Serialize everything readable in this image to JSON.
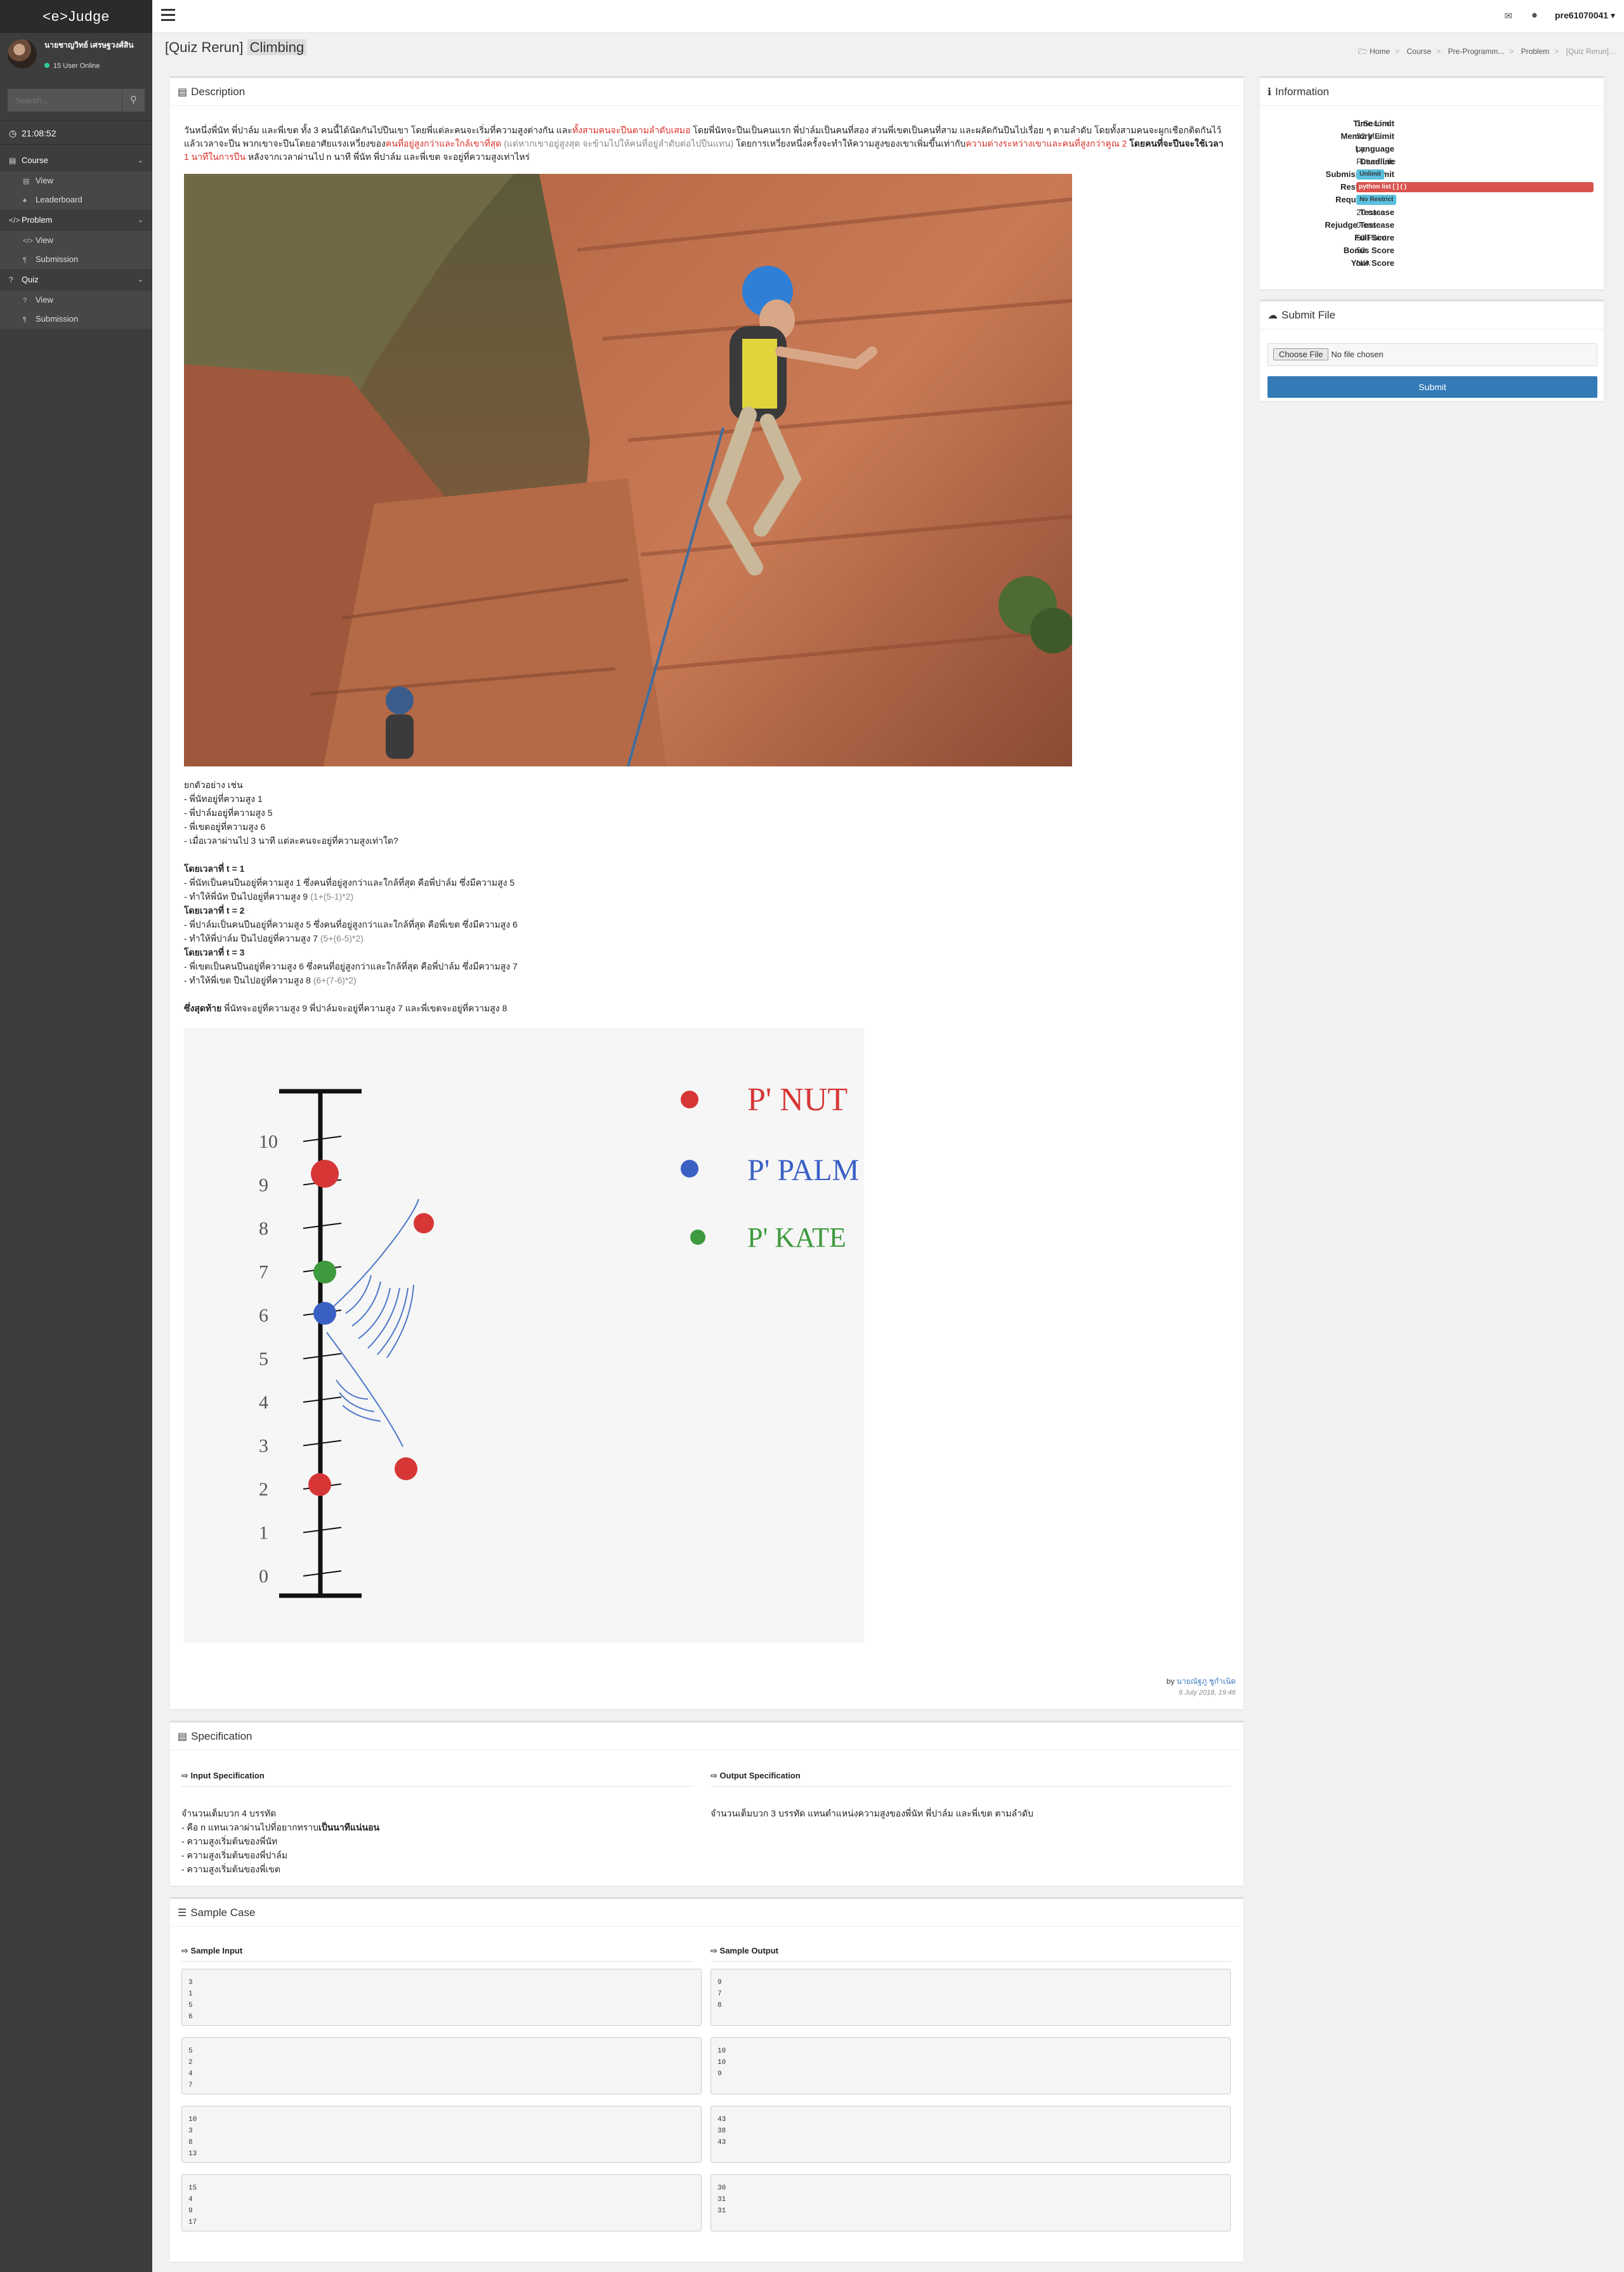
{
  "sidebar": {
    "brand": "<e>Judge",
    "user_name": "นายชาญวิทย์ เศรษฐวงศ์สิน",
    "online": "15 User Online",
    "search_placeholder": "Search...",
    "clock": "21:08:52",
    "course": {
      "label": "Course",
      "items": [
        "View",
        "Leaderboard"
      ]
    },
    "problem": {
      "label": "Problem",
      "items": [
        "View",
        "Submission"
      ]
    },
    "quiz": {
      "label": "Quiz",
      "items": [
        "View",
        "Submission"
      ]
    }
  },
  "topbar": {
    "user": "pre61070041 ▾"
  },
  "header": {
    "title_prefix": "[Quiz Rerun] ",
    "title_highlight": "Climbing",
    "breadcrumb": [
      "Home",
      "Course",
      "Pre-Programm...",
      "Problem",
      "[Quiz Rerun]..."
    ]
  },
  "description": {
    "title": "Description",
    "p1_a": "วันหนึ่งพี่นัท พี่ปาล์ม และพี่เขต ทั้ง 3 คนนี้ได้นัดกันไปปีนเขา โดยพี่แต่ละคนจะเริ่มที่ความสูงต่างกัน และ",
    "p1_red": "ทั้งสามคนจะปีนตามลำดับเสมอ",
    "p1_b": " โดยพี่นัทจะปีนเป็นคนแรก พี่ปาล์มเป็นคนที่สอง ส่วนพี่เขตเป็นคนที่สาม และผลัดกันปีนไปเรื่อย ๆ ตามลำดับ โดยทั้งสามคนจะผูกเชือกติดกันไว้ แล้วเวลาจะปีน พวกเขาจะปีนโดยอาศัยแรงเหวี่ยงของ",
    "p1_red2": "คนที่อยู่สูงกว่าและใกล้เขาที่สุด",
    "p1_grey": " (แต่หากเขาอยู่สูงสุด จะข้ามไปให้คนที่อยู่ลำดับต่อไปปีนแทน)",
    "p1_c": " โดยการเหวี่ยงหนึ่งครั้งจะทำให้ความสูงของเขาเพิ่มขึ้นเท่ากับ",
    "p1_red3": "ความต่างระหว่างเขาและคนที่สูงกว่าคูณ 2",
    "p1_d_bold": " โดยคนที่จะปีนจะใช้เวลา ",
    "p1_red4": "1 นาทีในการปีน",
    "p1_e": " หลังจากเวลาผ่านไป n นาที พี่นัท พี่ปาล์ม และพี่เขต จะอยู่ที่ความสูงเท่าไหร่",
    "example_intro": "ยกตัวอย่าง เช่น",
    "example_lines": [
      "- พี่นัทอยู่ที่ความสูง 1",
      "- พี่ปาล์มอยู่ที่ความสูง 5",
      "- พี่เขตอยู่ที่ความสูง  6",
      "- เมื่อเวลาผ่านไป 3 นาที แต่ละคนจะอยู่ที่ความสูงเท่าใด?"
    ],
    "t1_head": "โดยเวลาที่ t = 1",
    "t1_a": "- พี่นัทเป็นคนปีนอยู่ที่ความสูง 1 ซึ่งคนที่อยู่สูงกว่าและใกล้ที่สุด คือพี่ปาล์ม ซึ่งมีความสูง 5",
    "t1_b": "- ทำให้พี่นัท ปีนไปอยู่ที่ความสูง 9",
    "t1_b_grey": " (1+(5-1)*2)",
    "t2_head": "โดยเวลาที่ t = 2",
    "t2_a": "- พี่ปาล์มเป็นคนปีนอยู่ที่ความสูง 5 ซึ่งคนที่อยู่สูงกว่าและใกล้ที่สุด คือพี่เขต ซึ่งมีความสูง 6",
    "t2_b": "- ทำให้พี่ปาล์ม ปีนไปอยู่ที่ความสูง 7",
    "t2_b_grey": " (5+(6-5)*2)",
    "t3_head": "โดยเวลาที่ t = 3",
    "t3_a": "- พี่เขตเป็นคนปีนอยู่ที่ความสูง 6 ซึ่งคนที่อยู่สูงกว่าและใกล้ที่สุด คือพี่ปาล์ม ซึ่งมีความสูง 7",
    "t3_b": "- ทำให้พี่เขต ปีนไปอยู่ที่ความสูง 8",
    "t3_b_grey": " (6+(7-6)*2)",
    "final_bold": "ซึ่งสุดท้าย",
    "final_rest": " พี่นัทจะอยู่ที่ความสูง 9 พี่ปาล์มจะอยู่ที่ความสูง 7 และพี่เขตจะอยู่ที่ความสูง 8",
    "diagram": {
      "ticks": [
        "10",
        "9",
        "8",
        "7",
        "6",
        "5",
        "4",
        "3",
        "2",
        "1",
        "0"
      ],
      "legend": [
        "P' NUT",
        "P' PALM",
        "P' KATE"
      ]
    },
    "author_prefix": "by ",
    "author": "นายณัฐภู ชูกำเนิด",
    "date": "6 July 2018, 19:46"
  },
  "specification": {
    "title": "Specification",
    "input_head": "Input Specification",
    "output_head": "Output Specification",
    "input_lines": [
      "จำนวนเต็มบวก 4 บรรทัด",
      "- คือ n แทนเวลาผ่านไปที่อยากทราบ",
      "- ความสูงเริ่มต้นของพี่นัท",
      "- ความสูงเริ่มต้นของพี่ปาล์ม",
      "- ความสูงเริ่มต้นของพี่เขต"
    ],
    "input_bold": "เป็นนาทีแน่นอน",
    "output_text": "จำนวนเต็มบวก 3 บรรทัด แทนตำแหน่งความสูงของพี่นัท พี่ปาล์ม และพี่เขต ตามลำดับ"
  },
  "samples": {
    "title": "Sample Case",
    "input_head": "Sample Input",
    "output_head": "Sample Output",
    "inputs": [
      "3\n1\n5\n6",
      "5\n2\n4\n7",
      "10\n3\n8\n13",
      "15\n4\n9\n17"
    ],
    "outputs": [
      "9\n7\n8",
      "10\n10\n9",
      "43\n38\n43",
      "30\n31\n31"
    ]
  },
  "info": {
    "title": "Information",
    "rows": [
      {
        "k": "Time Limit",
        "v": "1 Second"
      },
      {
        "k": "Memory Limit",
        "v": "32 MB"
      },
      {
        "k": "Language",
        "v": "py"
      },
      {
        "k": "Deadline",
        "v": "Future Life"
      },
      {
        "k": "Submission Limit",
        "v": "Unlimit"
      },
      {
        "k": "Restrict Word",
        "v": "python list [ ] ( )"
      },
      {
        "k": "Required Word",
        "v": "No Restrict"
      },
      {
        "k": "Testcase",
        "v": "20 case"
      },
      {
        "k": "Rejudge Testcase",
        "v": "0 case"
      },
      {
        "k": "Full Score",
        "v": "50 Point"
      },
      {
        "k": "Bonus Score",
        "v": "50"
      },
      {
        "k": "Your Score",
        "v": "N/A"
      }
    ]
  },
  "file": {
    "title": "Submit File",
    "choose": "Choose File",
    "no_file": "No file chosen",
    "submit": "Submit"
  },
  "colors": {
    "accent": "#337ab7",
    "red": "#d9302b",
    "sidebar": "#3d3d3d"
  }
}
